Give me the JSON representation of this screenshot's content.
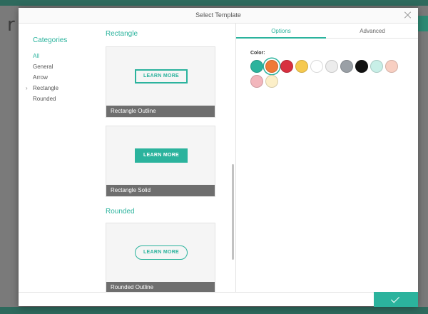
{
  "background": {
    "glyph": "r"
  },
  "modal": {
    "title": "Select Template",
    "close_icon": "close-icon"
  },
  "categories": {
    "title": "Categories",
    "items": [
      {
        "label": "All",
        "active": true
      },
      {
        "label": "General",
        "active": false
      },
      {
        "label": "Arrow",
        "active": false
      },
      {
        "label": "Rectangle",
        "active": false,
        "expanded": true
      },
      {
        "label": "Rounded",
        "active": false
      }
    ]
  },
  "templates": {
    "sections": [
      {
        "heading": "Rectangle",
        "cards": [
          {
            "button_label": "LEARN MORE",
            "caption": "Rectangle Outline",
            "style": "outline"
          },
          {
            "button_label": "LEARN MORE",
            "caption": "Rectangle Solid",
            "style": "solid"
          }
        ]
      },
      {
        "heading": "Rounded",
        "cards": [
          {
            "button_label": "LEARN MORE",
            "caption": "Rounded Outline",
            "style": "rounded"
          }
        ]
      }
    ]
  },
  "panel": {
    "tabs": [
      {
        "label": "Options",
        "active": true
      },
      {
        "label": "Advanced",
        "active": false
      }
    ],
    "color_label": "Color:",
    "swatches": [
      {
        "color": "#2bb39d",
        "selected": false
      },
      {
        "color": "#f07a37",
        "selected": true
      },
      {
        "color": "#d8303f",
        "selected": false
      },
      {
        "color": "#f6c94e",
        "selected": false
      },
      {
        "color": "#ffffff",
        "selected": false
      },
      {
        "color": "#ececec",
        "selected": false
      },
      {
        "color": "#9aa0a6",
        "selected": false
      },
      {
        "color": "#111111",
        "selected": false
      },
      {
        "color": "#c8efe7",
        "selected": false
      },
      {
        "color": "#f8cfc2",
        "selected": false
      },
      {
        "color": "#f2b6bc",
        "selected": false
      },
      {
        "color": "#fcefc8",
        "selected": false
      }
    ]
  },
  "footer": {
    "confirm_icon": "check-icon"
  },
  "colors": {
    "accent": "#2bb39d",
    "caption_bg": "#6e6e6e"
  }
}
